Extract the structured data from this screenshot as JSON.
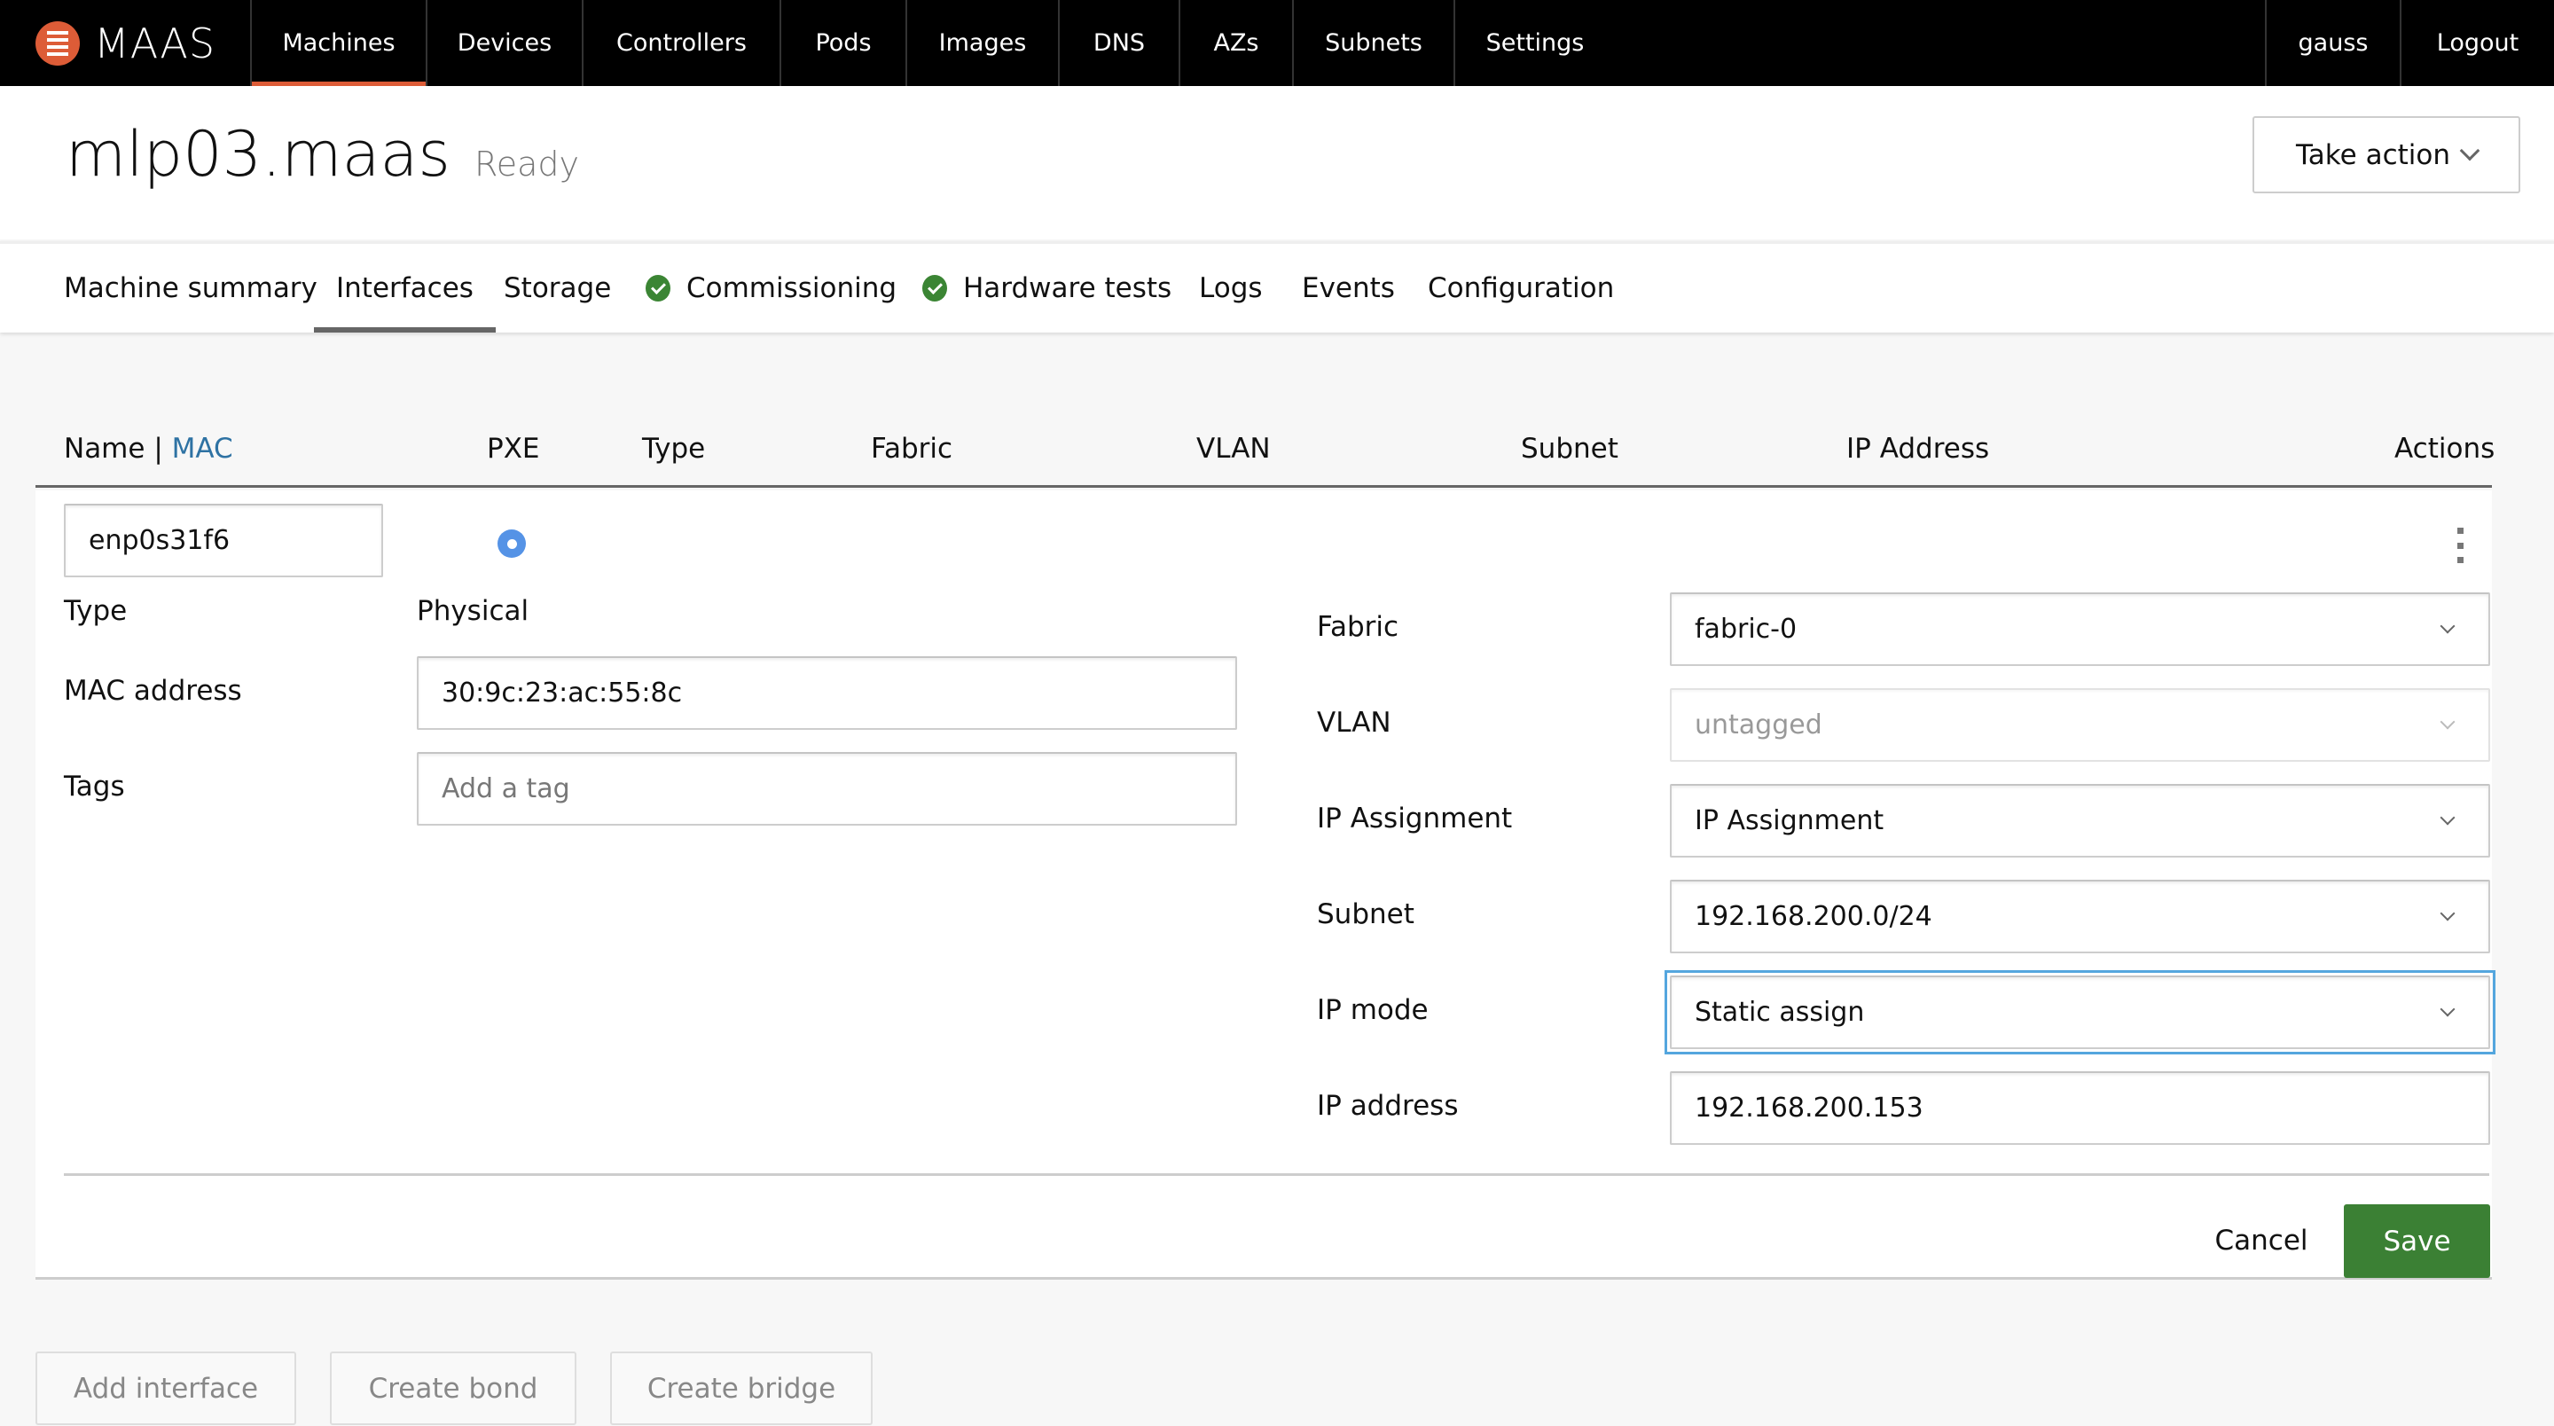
{
  "nav": {
    "brand": "MAAS",
    "accent_color": "#dd5c37",
    "items": [
      {
        "label": "Machines",
        "active": true
      },
      {
        "label": "Devices"
      },
      {
        "label": "Controllers"
      },
      {
        "label": "Pods"
      },
      {
        "label": "Images"
      },
      {
        "label": "DNS"
      },
      {
        "label": "AZs"
      },
      {
        "label": "Subnets"
      },
      {
        "label": "Settings"
      }
    ],
    "user": "gauss",
    "logout": "Logout"
  },
  "header": {
    "title": "mlp03.maas",
    "status": "Ready",
    "take_action": "Take action"
  },
  "tabs": [
    {
      "label": "Machine summary"
    },
    {
      "label": "Interfaces",
      "active": true
    },
    {
      "label": "Storage"
    },
    {
      "label": "Commissioning",
      "icon": "success-check-icon"
    },
    {
      "label": "Hardware tests",
      "icon": "success-check-icon"
    },
    {
      "label": "Logs"
    },
    {
      "label": "Events"
    },
    {
      "label": "Configuration"
    }
  ],
  "table": {
    "columns": {
      "name": "Name",
      "separator": "|",
      "mac": "MAC",
      "pxe": "PXE",
      "type": "Type",
      "fabric": "Fabric",
      "vlan": "VLAN",
      "subnet": "Subnet",
      "ip_address": "IP Address",
      "actions": "Actions"
    }
  },
  "edit_form": {
    "name_value": "enp0s31f6",
    "pxe_selected": true,
    "type_label": "Type",
    "type_value": "Physical",
    "mac_label": "MAC address",
    "mac_value": "30:9c:23:ac:55:8c",
    "tags_label": "Tags",
    "tags_placeholder": "Add a tag",
    "fabric_label": "Fabric",
    "fabric_value": "fabric-0",
    "vlan_label": "VLAN",
    "vlan_value": "untagged",
    "ip_assignment_label": "IP Assignment",
    "ip_assignment_value": "IP Assignment",
    "subnet_label": "Subnet",
    "subnet_value": "192.168.200.0/24",
    "ip_mode_label": "IP mode",
    "ip_mode_value": "Static assign",
    "ip_address_label": "IP address",
    "ip_address_value": "192.168.200.153",
    "cancel": "Cancel",
    "save": "Save",
    "save_color": "#3b8034"
  },
  "bottom_actions": {
    "add_interface": "Add interface",
    "create_bond": "Create bond",
    "create_bridge": "Create bridge"
  }
}
